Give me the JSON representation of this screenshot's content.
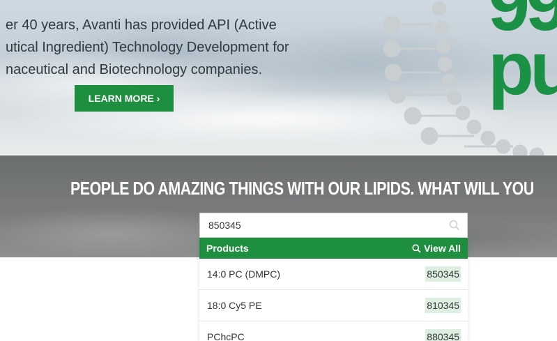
{
  "hero": {
    "lines": [
      "er 40 years, Avanti has provided API (Active",
      "utical Ingredient) Technology Development for",
      "naceutical and Biotechnology companies."
    ],
    "learn_more": "LEARN MORE ›",
    "big_text": "99\npu"
  },
  "band": {
    "tagline": "PEOPLE DO AMAZING THINGS WITH OUR LIPIDS. WHAT WILL YOU"
  },
  "search": {
    "value": "850345"
  },
  "dropdown": {
    "header": "Products",
    "view_all": "View All",
    "results": [
      {
        "name": "14:0 PC (DMPC)",
        "catalog": "850345"
      },
      {
        "name": "18:0 Cy5 PE",
        "catalog": "810345"
      },
      {
        "name": "PChcPC",
        "catalog": "880345"
      }
    ]
  },
  "colors": {
    "brand_green": "#1e8f3f",
    "highlight": "#dcefe1"
  }
}
